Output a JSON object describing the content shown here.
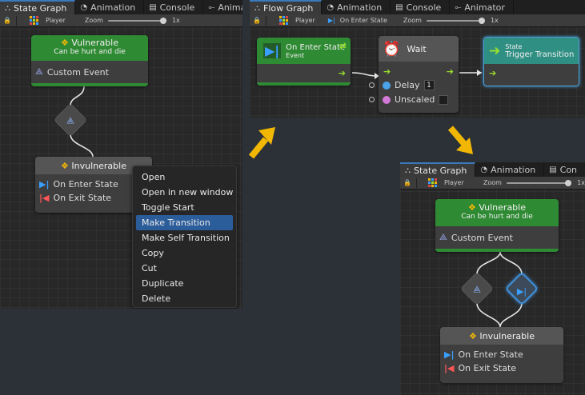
{
  "panel1": {
    "tabs": [
      {
        "icon": "state-graph-icon",
        "label": "State Graph",
        "active": true
      },
      {
        "icon": "clock-icon",
        "label": "Animation",
        "active": false
      },
      {
        "icon": "console-icon",
        "label": "Console",
        "active": false
      },
      {
        "icon": "animator-icon",
        "label": "Anima",
        "active": false
      }
    ],
    "toolbar": {
      "object": "Player",
      "zoom_label": "Zoom",
      "zoom_value": "1x"
    },
    "node_vulnerable": {
      "title": "Vulnerable",
      "subtitle": "Can be hurt and die",
      "event": "Custom Event"
    },
    "node_invulnerable": {
      "title": "Invulnerable",
      "enter": "On Enter State",
      "exit": "On Exit State"
    }
  },
  "context_menu": {
    "items": [
      "Open",
      "Open in new window",
      "Toggle Start",
      "Make Transition",
      "Make Self Transition",
      "Copy",
      "Cut",
      "Duplicate",
      "Delete"
    ],
    "selected": "Make Transition"
  },
  "panel2": {
    "tabs": [
      {
        "icon": "flow-graph-icon",
        "label": "Flow Graph",
        "active": true
      },
      {
        "icon": "clock-icon",
        "label": "Animation",
        "active": false
      },
      {
        "icon": "console-icon",
        "label": "Console",
        "active": false
      },
      {
        "icon": "animator-icon",
        "label": "Animator",
        "active": false
      }
    ],
    "toolbar": {
      "object": "Player",
      "state": "On Enter State",
      "zoom_label": "Zoom",
      "zoom_value": "1x"
    },
    "node_enter": {
      "title": "On Enter State",
      "subtitle": "Event"
    },
    "node_wait": {
      "title": "Wait",
      "delay_label": "Delay",
      "delay_value": "1",
      "unscaled_label": "Unscaled"
    },
    "node_trigger": {
      "kicker": "State",
      "title": "Trigger Transition"
    }
  },
  "panel3": {
    "tabs": [
      {
        "icon": "state-graph-icon",
        "label": "State Graph",
        "active": true
      },
      {
        "icon": "clock-icon",
        "label": "Animation",
        "active": false
      },
      {
        "icon": "console-icon",
        "label": "Con",
        "active": false
      }
    ],
    "toolbar": {
      "object": "Player",
      "zoom_label": "Zoom",
      "zoom_value": "1x"
    },
    "node_vulnerable": {
      "title": "Vulnerable",
      "subtitle": "Can be hurt and die",
      "event": "Custom Event"
    },
    "node_invulnerable": {
      "title": "Invulnerable",
      "enter": "On Enter State",
      "exit": "On Exit State"
    }
  },
  "colors": {
    "accent": "#2c5d9b",
    "node_green": "#2f8a34",
    "port_green": "#9be02d",
    "arrow_yellow": "#f2b705",
    "enter_blue": "#3aa0ff",
    "exit_red": "#ff5555",
    "trigger_teal": "#2f8f83"
  }
}
